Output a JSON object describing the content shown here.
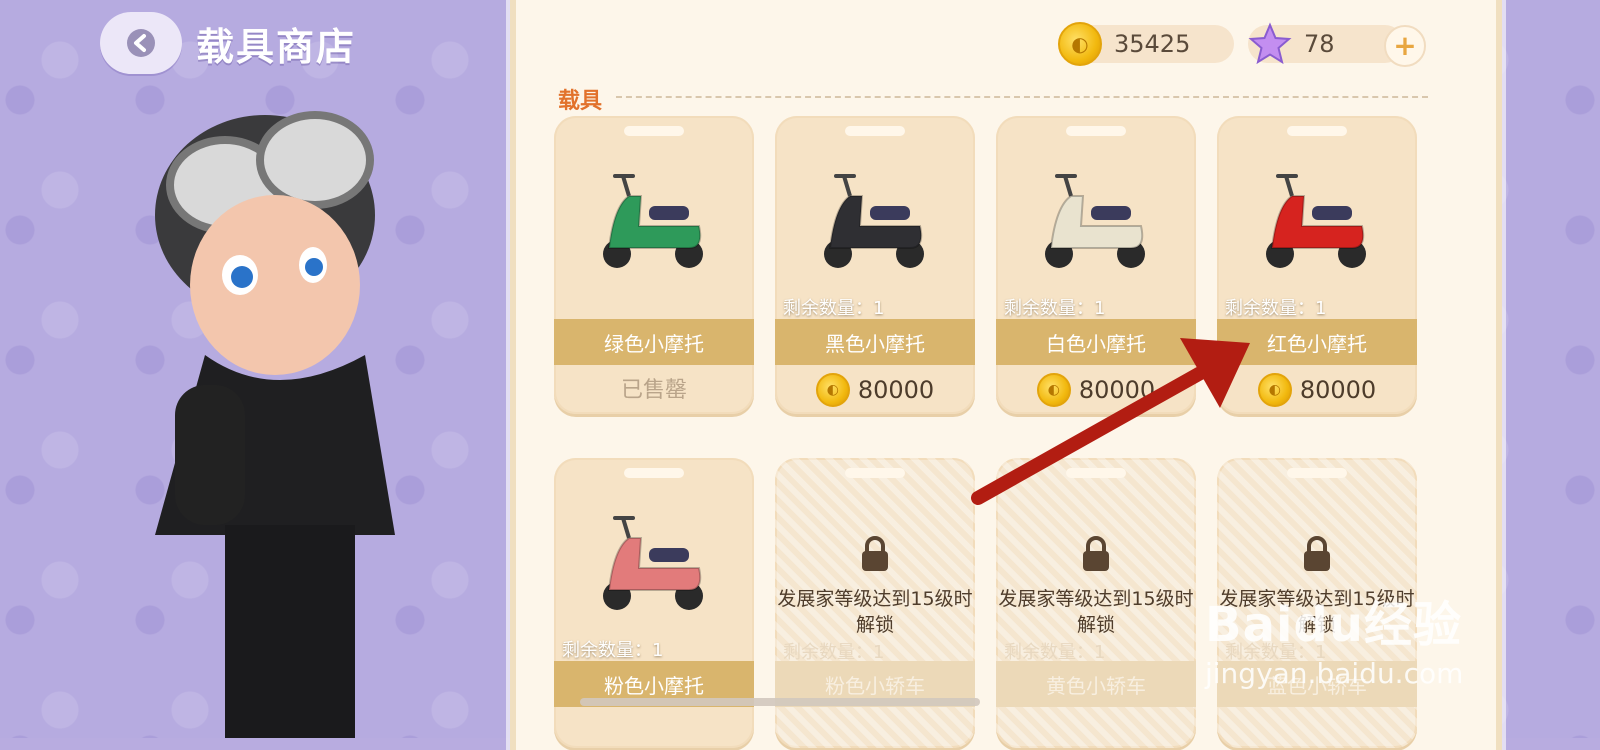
{
  "header": {
    "title": "载具商店"
  },
  "currency": {
    "coins": "35425",
    "stars": "78",
    "plus": "+"
  },
  "section": {
    "label": "载具"
  },
  "vehicles": [
    {
      "name": "绿色小摩托",
      "qty": "",
      "price": "",
      "status": "已售罄",
      "color": "#2e9a5a"
    },
    {
      "name": "黑色小摩托",
      "qty": "剩余数量：1",
      "price": "80000",
      "status": "",
      "color": "#2f2f33"
    },
    {
      "name": "白色小摩托",
      "qty": "剩余数量：1",
      "price": "80000",
      "status": "",
      "color": "#e9e3cf"
    },
    {
      "name": "红色小摩托",
      "qty": "剩余数量：1",
      "price": "80000",
      "status": "",
      "color": "#d6231f"
    },
    {
      "name": "粉色小摩托",
      "qty": "剩余数量：1",
      "price": "",
      "status": "",
      "color": "#e27b7b"
    }
  ],
  "locked": [
    {
      "unlock": "发展家等级达到15级时解锁",
      "qty": "剩余数量：1",
      "name": "粉色小轿车"
    },
    {
      "unlock": "发展家等级达到15级时解锁",
      "qty": "剩余数量：1",
      "name": "黄色小轿车"
    },
    {
      "unlock": "发展家等级达到15级时解锁",
      "qty": "剩余数量：1",
      "name": "蓝色小轿车"
    }
  ],
  "watermark": {
    "brand": "Baidu经验",
    "url": "jingyan.baidu.com"
  }
}
